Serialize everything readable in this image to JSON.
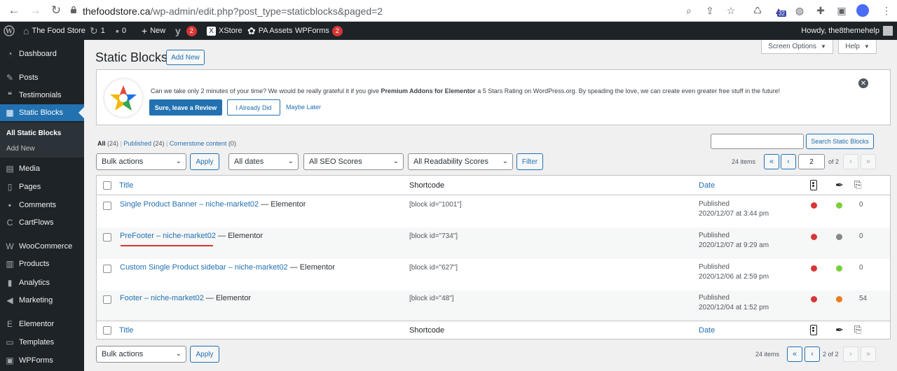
{
  "browser": {
    "url_domain": "thefoodstore.ca",
    "url_path": "/wp-admin/edit.php?post_type=staticblocks&paged=2",
    "ext_badge": "32"
  },
  "admin_bar": {
    "site_name": "The Food Store",
    "updates": "1",
    "comments": "0",
    "new_label": "New",
    "yoast_count": "2",
    "xstore": "XStore",
    "pa_assets": "PA Assets",
    "wpforms": "WPForms",
    "wpforms_count": "2",
    "howdy": "Howdy, the8themehelp"
  },
  "sidebar": {
    "items": [
      {
        "label": "Dashboard",
        "icon": "dashboard-icon"
      },
      {
        "label": "Posts",
        "icon": "pin-icon"
      },
      {
        "label": "Testimonials",
        "icon": "speech-icon"
      },
      {
        "label": "Static Blocks",
        "icon": "grid-icon"
      },
      {
        "label": "Media",
        "icon": "media-icon"
      },
      {
        "label": "Pages",
        "icon": "page-icon"
      },
      {
        "label": "Comments",
        "icon": "comment-icon"
      },
      {
        "label": "CartFlows",
        "icon": "cartflows-icon"
      },
      {
        "label": "WooCommerce",
        "icon": "woo-icon"
      },
      {
        "label": "Products",
        "icon": "products-icon"
      },
      {
        "label": "Analytics",
        "icon": "analytics-icon"
      },
      {
        "label": "Marketing",
        "icon": "megaphone-icon"
      },
      {
        "label": "Elementor",
        "icon": "elementor-icon"
      },
      {
        "label": "Templates",
        "icon": "folder-icon"
      },
      {
        "label": "WPForms",
        "icon": "wpforms-icon"
      }
    ],
    "submenu": [
      "All Static Blocks",
      "Add New"
    ]
  },
  "header": {
    "title": "Static Blocks",
    "add_new": "Add New",
    "screen_options": "Screen Options",
    "help": "Help"
  },
  "notice": {
    "text_before": "Can we take only 2 minutes of your time? We would be really grateful it if you give ",
    "text_bold": "Premium Addons for Elementor",
    "text_after": " a 5 Stars Rating on WordPress.org. By speading the love, we can create even greater free stuff in the future!",
    "review_btn": "Sure, leave a Review",
    "already_btn": "I Already Did",
    "later_link": "Maybe Later"
  },
  "filters": {
    "all": "All",
    "all_count": "(24)",
    "published": "Published",
    "published_count": "(24)",
    "cornerstone": "Cornerstone content",
    "cornerstone_count": "(0)",
    "search_btn": "Search Static Blocks",
    "bulk_actions": "Bulk actions",
    "apply": "Apply",
    "all_dates": "All dates",
    "seo_scores": "All SEO Scores",
    "readability": "All Readability Scores",
    "filter_btn": "Filter",
    "items_count": "24 items",
    "current_page": "2",
    "of_pages": "of 2",
    "bottom_pages": "2 of 2"
  },
  "table": {
    "col_title": "Title",
    "col_shortcode": "Shortcode",
    "col_date": "Date",
    "rows": [
      {
        "title": "Single Product Banner – niche-market02",
        "state": "— Elementor",
        "shortcode": "[block id=\"1001\"]",
        "status": "Published",
        "date": "2020/12/07 at 3:44 pm",
        "seo": "#d63638",
        "readability": "#7ad03a",
        "links": "0"
      },
      {
        "title": "PreFooter – niche-market02",
        "state": "— Elementor",
        "shortcode": "[block id=\"734\"]",
        "status": "Published",
        "date": "2020/12/07 at 9:29 am",
        "seo": "#d63638",
        "readability": "#888888",
        "links": "0"
      },
      {
        "title": "Custom Single Product sidebar – niche-market02",
        "state": "— Elementor",
        "shortcode": "[block id=\"627\"]",
        "status": "Published",
        "date": "2020/12/06 at 2:59 pm",
        "seo": "#d63638",
        "readability": "#7ad03a",
        "links": "0"
      },
      {
        "title": "Footer – niche-market02",
        "state": "— Elementor",
        "shortcode": "[block id=\"48\"]",
        "status": "Published",
        "date": "2020/12/04 at 1:52 pm",
        "seo": "#d63638",
        "readability": "#ee7c1b",
        "links": "54"
      }
    ]
  },
  "colors": {
    "wp_blue": "#2271b1",
    "admin_dark": "#1d2327",
    "underline_red": "#d63638"
  }
}
